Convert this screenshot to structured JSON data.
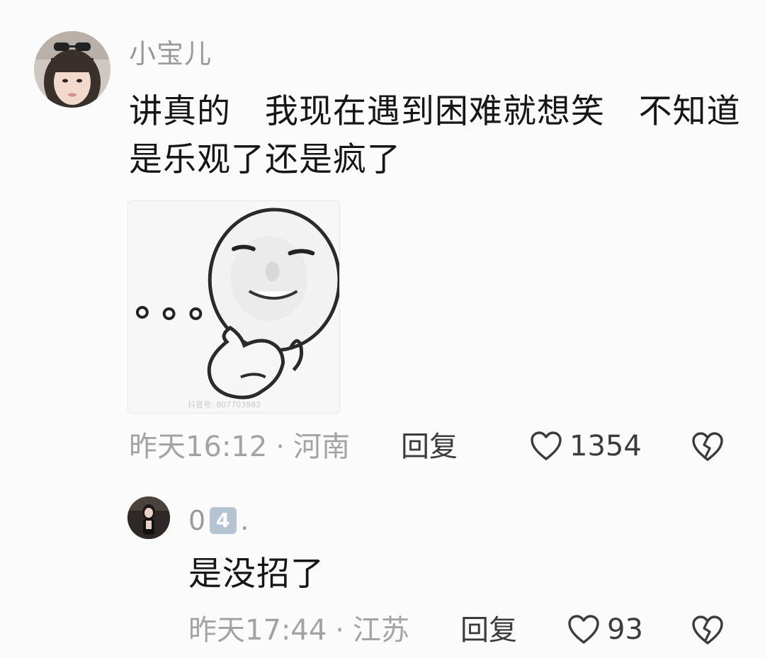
{
  "comment": {
    "username": "小宝儿",
    "avatar": "profile-photo-girl-with-sunglasses-on-head",
    "text": "讲真的   我现在遇到困难就想笑   不知道是乐观了还是疯了",
    "sticker": {
      "type": "meme-sticker",
      "description_icon": "smiling-face-thinking-meme",
      "watermark": "抖音号: 807703982"
    },
    "time": "昨天16:12",
    "separator": "·",
    "location": "河南",
    "reply_label": "回复",
    "like_count": "1354",
    "like_icon": "heart-outline-icon",
    "dislike_icon": "broken-heart-icon"
  },
  "reply": {
    "username_prefix": "0",
    "username_keycap": "4",
    "username_suffix": ".",
    "avatar": "profile-photo-dark",
    "text": "是没招了",
    "time": "昨天17:44",
    "separator": "·",
    "location": "江苏",
    "reply_label": "回复",
    "like_count": "93",
    "like_icon": "heart-outline-icon",
    "dislike_icon": "broken-heart-icon"
  },
  "colors": {
    "background": "#fbfbfb",
    "username": "#9a9a9a",
    "meta": "#a3a3a3",
    "text": "#161616",
    "action": "#3b3b3b",
    "keycap": "#b4c4d2"
  }
}
